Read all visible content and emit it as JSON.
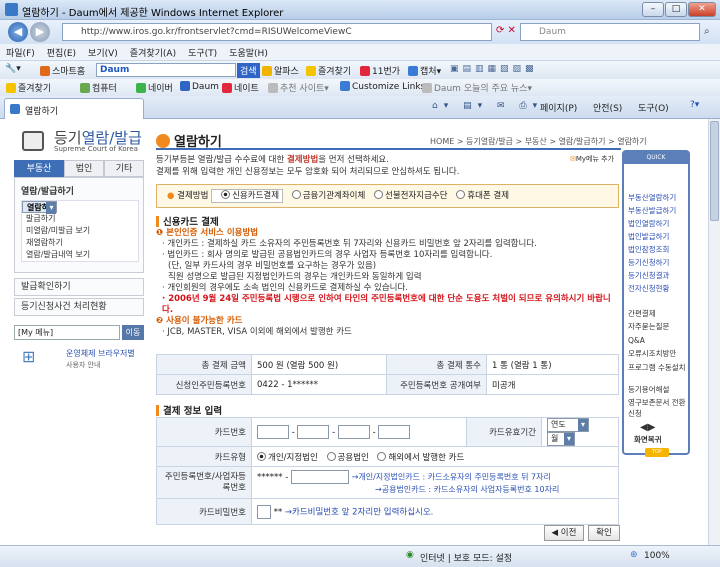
{
  "window": {
    "title": "열람하기 - Daum에서 제공한 Windows Internet Explorer",
    "min": "–",
    "max": "□",
    "close": "✕"
  },
  "address": {
    "url": "http://www.iros.go.kr/frontservlet?cmd=RISUWelcomeViewC",
    "search_placeholder": "Daum"
  },
  "menubar": [
    "파일(F)",
    "편집(E)",
    "보기(V)",
    "즐겨찾기(A)",
    "도구(T)",
    "도움말(H)"
  ],
  "toolbar1": {
    "smarthome": "스마트홈",
    "daum_logo": "Daum",
    "search_btn": "검색",
    "alpas": "알파스",
    "fav": "즐겨찾기",
    "elevenst": "11번가",
    "capture": "캡처"
  },
  "toolbar2": {
    "favorites": "즐겨찾기",
    "links": [
      "컴퓨터",
      "네이버",
      "Daum",
      "네이트",
      "추천 사이트",
      "Customize Links",
      "Daum 오늘의 주요 뉴스"
    ]
  },
  "tabs": {
    "active": "열람하기",
    "page_menu": "페이지(P)",
    "safety_menu": "안전(S)",
    "tools_menu": "도구(O)"
  },
  "sidebar": {
    "logo_main": "등기",
    "logo_sub": "열람/발급",
    "logo_en": "Supreme Court of Korea",
    "tabs": [
      "부동산",
      "법인",
      "기타"
    ],
    "menu_title": "열람/발급하기",
    "menu_items": [
      "열람하기",
      "발급하기",
      "미열람/미발급 보기",
      "재열람하기",
      "열람/발급내역 보기"
    ],
    "sec2": "발급확인하기",
    "sec3": "등기신청사건 처리현황",
    "mymenu": "[My 메뉴]",
    "go": "이동",
    "os_link": "운영체제 브라우저별",
    "os_sub": "사용자 안내"
  },
  "main": {
    "title": "열람하기",
    "breadcrumb": "HOME > 등기열람/발급 > 부동산 > 열람/발급하기 > 열람하기",
    "intro_1a": "등기부등본 열람/발급 수수료에 대한 ",
    "intro_1b": "결제방법",
    "intro_1c": "을 먼저 선택하세요.",
    "intro_2": "결제를 위해 입력한 개인 신용정보는 모두 암호화 되어 처리되므로 안심하셔도 됩니다.",
    "my_help": "My메뉴 추가",
    "pay_label": "결제방법",
    "pay_options": [
      "신용카드결제",
      "금융기관계좌이체",
      "선불전자지급수단",
      "휴대폰 결제"
    ],
    "card_section": "신용카드 결제",
    "auth_title": "본인인증 서비스 이용방법",
    "auth_1": "· 개인카드 : 결제하실 카드 소유자의 주민등록번호 뒤 7자리와 신용카드 비밀번호 앞 2자리를 입력합니다.",
    "auth_2": "· 법인카드 : 회사 명의로 발급된 공용법인카드의 경우 사업자 등록번호 10자리를 입력합니다.",
    "auth_3": "(단, 일부 카드사의 경우 비밀번호를 요구하는 경우가 있음)",
    "auth_4": "직원 성명으로 발급된 지정법인카드의 경우는 개인카드와 동일하게 입력",
    "auth_5": "· 개인회원의 경우에도 소속 법인의 신용카드로 결제하실 수 있습니다.",
    "warn": "· 2006년 9월 24일 주민등록법 시행으로 인하여 타인의 주민등록번호에 대한 단순 도용도 처벌이 되므로 유의하시기 바랍니다.",
    "unavail_title": "사용이 불가능한 카드",
    "unavail": "· JCB, MASTER, VISA 이외에 해외에서 발행한 카드",
    "sum": {
      "total_label": "총 결제 금액",
      "total_value": "500 원 (열람 500 원)",
      "count_label": "총 결제 통수",
      "count_value": "1 통 (열람 1 통)",
      "id_label": "신청인주민등록번호",
      "id_value": "0422 - 1******",
      "public_label": "주민등록번호 공개여부",
      "public_value": "미공개"
    },
    "input_section": "결제 정보 입력",
    "card_no_label": "카드번호",
    "expiry_label": "카드유효기간",
    "expiry_year": "연도",
    "expiry_month": "월",
    "card_type_label": "카드유형",
    "card_types": [
      "개인/지정법인",
      "공용법인",
      "해외에서 발행한 카드"
    ],
    "rrn_label": "주민등록번호/사업자등록번호",
    "rrn_prefix": "******  -",
    "rrn_hint1": "→개인/지정법인카드 : 카드소유자의 주민등록번호 뒤 7자리",
    "rrn_hint2": "→공용법인카드 : 카드소유자의 사업자등록번호 10자리",
    "pw_label": "카드비밀번호",
    "pw_suffix": "**",
    "pw_hint": "→카드비밀번호 앞 2자리만 입력하십시오.",
    "prev_btn": "◀ 이전",
    "confirm_btn": "확인"
  },
  "quick": {
    "title": "QUICK",
    "items_blue": [
      "부동산열람하기",
      "부동산발급하기",
      "법인열람하기",
      "법인발급하기",
      "법인잠정조회",
      "등기신청하기",
      "등기신청결과",
      "전자신청현황"
    ],
    "items": [
      "간편결제",
      "자주묻는질문",
      "Q&A",
      "오류시조치방안",
      "프로그램 수동설치",
      "등기용어해설",
      "영구보존문서 전환신청"
    ],
    "remote": "화면복귀",
    "top": "TOP"
  },
  "status": {
    "zone": "인터넷 | 보호 모드: 설정",
    "zoom": "100%"
  }
}
